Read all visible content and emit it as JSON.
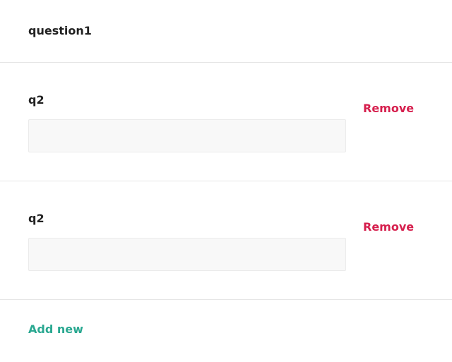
{
  "question": {
    "title": "question1"
  },
  "items": [
    {
      "label": "q2",
      "value": "",
      "remove_label": "Remove"
    },
    {
      "label": "q2",
      "value": "",
      "remove_label": "Remove"
    }
  ],
  "actions": {
    "add_label": "Add new"
  },
  "colors": {
    "remove": "#d6204e",
    "add": "#2aa891",
    "divider": "#e6e6e6",
    "input_bg": "#f8f8f8"
  }
}
